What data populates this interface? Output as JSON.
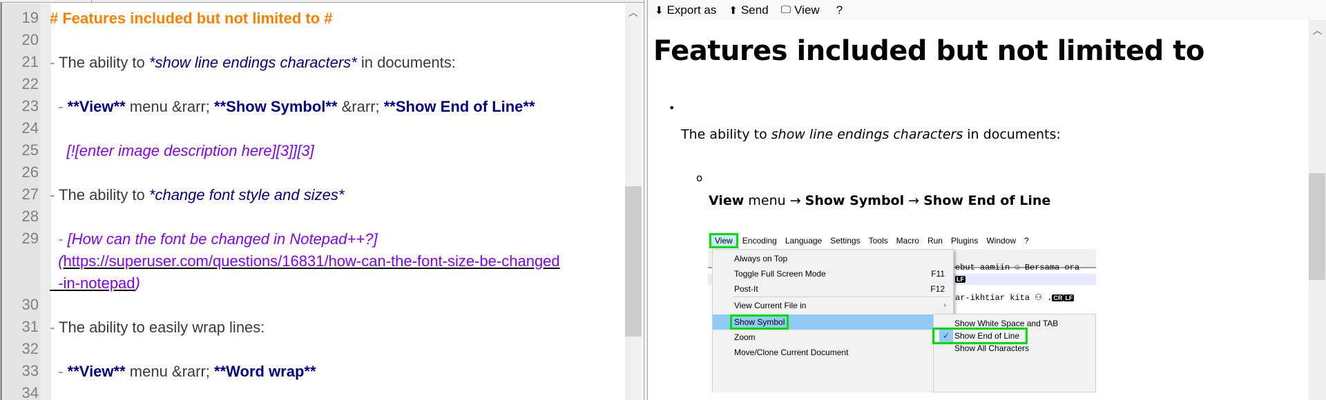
{
  "editor": {
    "lines": [
      {
        "num": "19",
        "segments": [
          {
            "cls": "h1",
            "text": "# Features included but not limited to #"
          }
        ]
      },
      {
        "num": "20",
        "segments": []
      },
      {
        "num": "21",
        "segments": [
          {
            "cls": "dash",
            "text": "- "
          },
          {
            "cls": "txt",
            "text": "The ability to "
          },
          {
            "cls": "em",
            "text": "*show line endings characters*"
          },
          {
            "cls": "txt",
            "text": " in documents:"
          }
        ]
      },
      {
        "num": "22",
        "segments": []
      },
      {
        "num": "23",
        "segments": [
          {
            "cls": "dash",
            "text": "  - "
          },
          {
            "cls": "strong",
            "text": "**View**"
          },
          {
            "cls": "txt",
            "text": " menu &rarr; "
          },
          {
            "cls": "strong",
            "text": "**Show Symbol**"
          },
          {
            "cls": "txt",
            "text": " &rarr; "
          },
          {
            "cls": "strong",
            "text": "**Show End of Line**"
          }
        ]
      },
      {
        "num": "24",
        "segments": []
      },
      {
        "num": "25",
        "segments": [
          {
            "cls": "txt",
            "text": "    "
          },
          {
            "cls": "link",
            "text": "[![enter image description here][3]]"
          },
          {
            "cls": "link",
            "text": "[3]"
          }
        ]
      },
      {
        "num": "26",
        "segments": []
      },
      {
        "num": "27",
        "segments": [
          {
            "cls": "dash",
            "text": "- "
          },
          {
            "cls": "txt",
            "text": "The ability to "
          },
          {
            "cls": "em",
            "text": "*change font style and sizes*"
          }
        ]
      },
      {
        "num": "28",
        "segments": []
      },
      {
        "num": "29",
        "segments": [
          {
            "cls": "dash",
            "text": "  - "
          },
          {
            "cls": "link",
            "text": "[How can the font be changed in Notepad++?]"
          }
        ]
      },
      {
        "num": "",
        "segments": [
          {
            "cls": "link",
            "text": "  ("
          },
          {
            "cls": "url",
            "text": "https://superuser.com/questions/16831/how-can-the-font-size-be-changed"
          }
        ]
      },
      {
        "num": "",
        "segments": [
          {
            "cls": "url",
            "text": "  -in-notepad"
          },
          {
            "cls": "link",
            "text": ")"
          }
        ]
      },
      {
        "num": "30",
        "segments": []
      },
      {
        "num": "31",
        "segments": [
          {
            "cls": "dash",
            "text": "- "
          },
          {
            "cls": "txt",
            "text": "The ability to easily wrap lines:"
          }
        ]
      },
      {
        "num": "32",
        "segments": []
      },
      {
        "num": "33",
        "segments": [
          {
            "cls": "dash",
            "text": "  - "
          },
          {
            "cls": "strong",
            "text": "**View**"
          },
          {
            "cls": "txt",
            "text": " menu &rarr; "
          },
          {
            "cls": "strong",
            "text": "**Word wrap**"
          }
        ]
      },
      {
        "num": "34",
        "segments": []
      }
    ]
  },
  "preview": {
    "toolbar": {
      "export_label": "Export as",
      "send_label": "Send",
      "view_label": "View",
      "help_label": "?"
    },
    "title": "Features included but not limited to",
    "bullet1_prefix": "The ability to ",
    "bullet1_em": "show line endings characters",
    "bullet1_suffix": " in documents:",
    "sub1": {
      "b1": "View",
      "t1": " menu → ",
      "b2": "Show Symbol",
      "t2": " → ",
      "b3": "Show End of Line"
    },
    "screenshot": {
      "menubar": [
        "View",
        "Encoding",
        "Language",
        "Settings",
        "Tools",
        "Macro",
        "Run",
        "Plugins",
        "Window",
        "?"
      ],
      "menu_items": [
        {
          "label": "Always on Top",
          "shortcut": "",
          "submenu": false
        },
        {
          "label": "Toggle Full Screen Mode",
          "shortcut": "F11",
          "submenu": false
        },
        {
          "label": "Post-It",
          "shortcut": "F12",
          "submenu": false
        },
        {
          "label": "View Current File in",
          "shortcut": "",
          "submenu": true
        },
        {
          "label": "Show Symbol",
          "shortcut": "",
          "submenu": true
        },
        {
          "label": "Zoom",
          "shortcut": "",
          "submenu": true
        },
        {
          "label": "Move/Clone Current Document",
          "shortcut": "",
          "submenu": true
        }
      ],
      "submenu_items": [
        {
          "label": "Show White Space and TAB",
          "checked": false
        },
        {
          "label": "Show End of Line",
          "checked": true
        },
        {
          "label": "Show All Characters",
          "checked": false
        }
      ],
      "bg_line1": "ebut aamiin ☺ Bersama ora",
      "bg_eol1": "LF",
      "bg_line2": "ar-ikhtiar kita ⚇ .",
      "bg_eol2a": "CR",
      "bg_eol2b": "LF",
      "highlight_color": "#00e000"
    }
  }
}
